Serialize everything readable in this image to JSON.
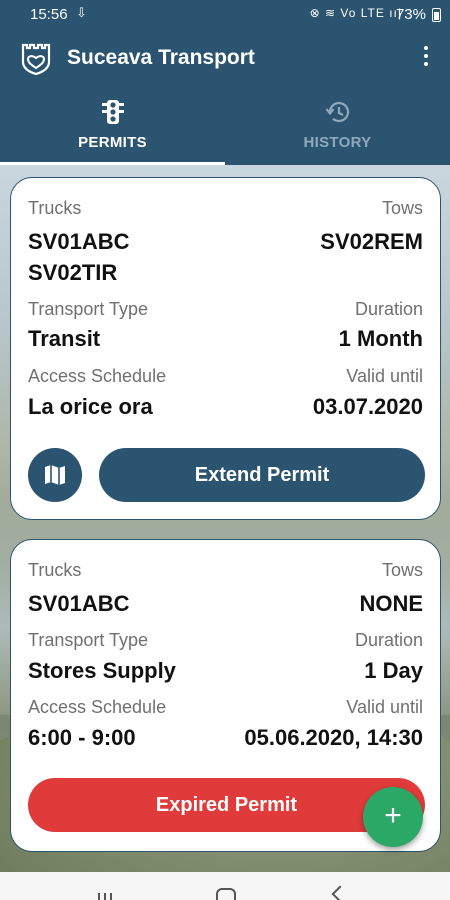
{
  "status": {
    "time": "15:56",
    "battery": "73%",
    "icons": "⊗ ≋ Vo LTE ıı|"
  },
  "app": {
    "title": "Suceava Transport"
  },
  "tabs": [
    {
      "label": "PERMITS",
      "active": true
    },
    {
      "label": "HISTORY",
      "active": false
    }
  ],
  "permits": [
    {
      "trucks_label": "Trucks",
      "trucks": [
        "SV01ABC",
        "SV02TIR"
      ],
      "tows_label": "Tows",
      "tows": "SV02REM",
      "transport_type_label": "Transport Type",
      "transport_type": "Transit",
      "duration_label": "Duration",
      "duration": "1 Month",
      "access_label": "Access Schedule",
      "access": "La orice ora",
      "valid_label": "Valid until",
      "valid": "03.07.2020",
      "action_label": "Extend Permit"
    },
    {
      "trucks_label": "Trucks",
      "trucks": [
        "SV01ABC"
      ],
      "tows_label": "Tows",
      "tows": "NONE",
      "transport_type_label": "Transport Type",
      "transport_type": "Stores Supply",
      "duration_label": "Duration",
      "duration": "1 Day",
      "access_label": "Access Schedule",
      "access": "6:00 - 9:00",
      "valid_label": "Valid until",
      "valid": "05.06.2020, 14:30",
      "action_label": "Expired Permit"
    }
  ],
  "fab": {
    "icon": "plus-icon",
    "glyph": "+"
  },
  "colors": {
    "primary": "#2b5470",
    "danger": "#e03a3a",
    "success": "#2ba866"
  }
}
